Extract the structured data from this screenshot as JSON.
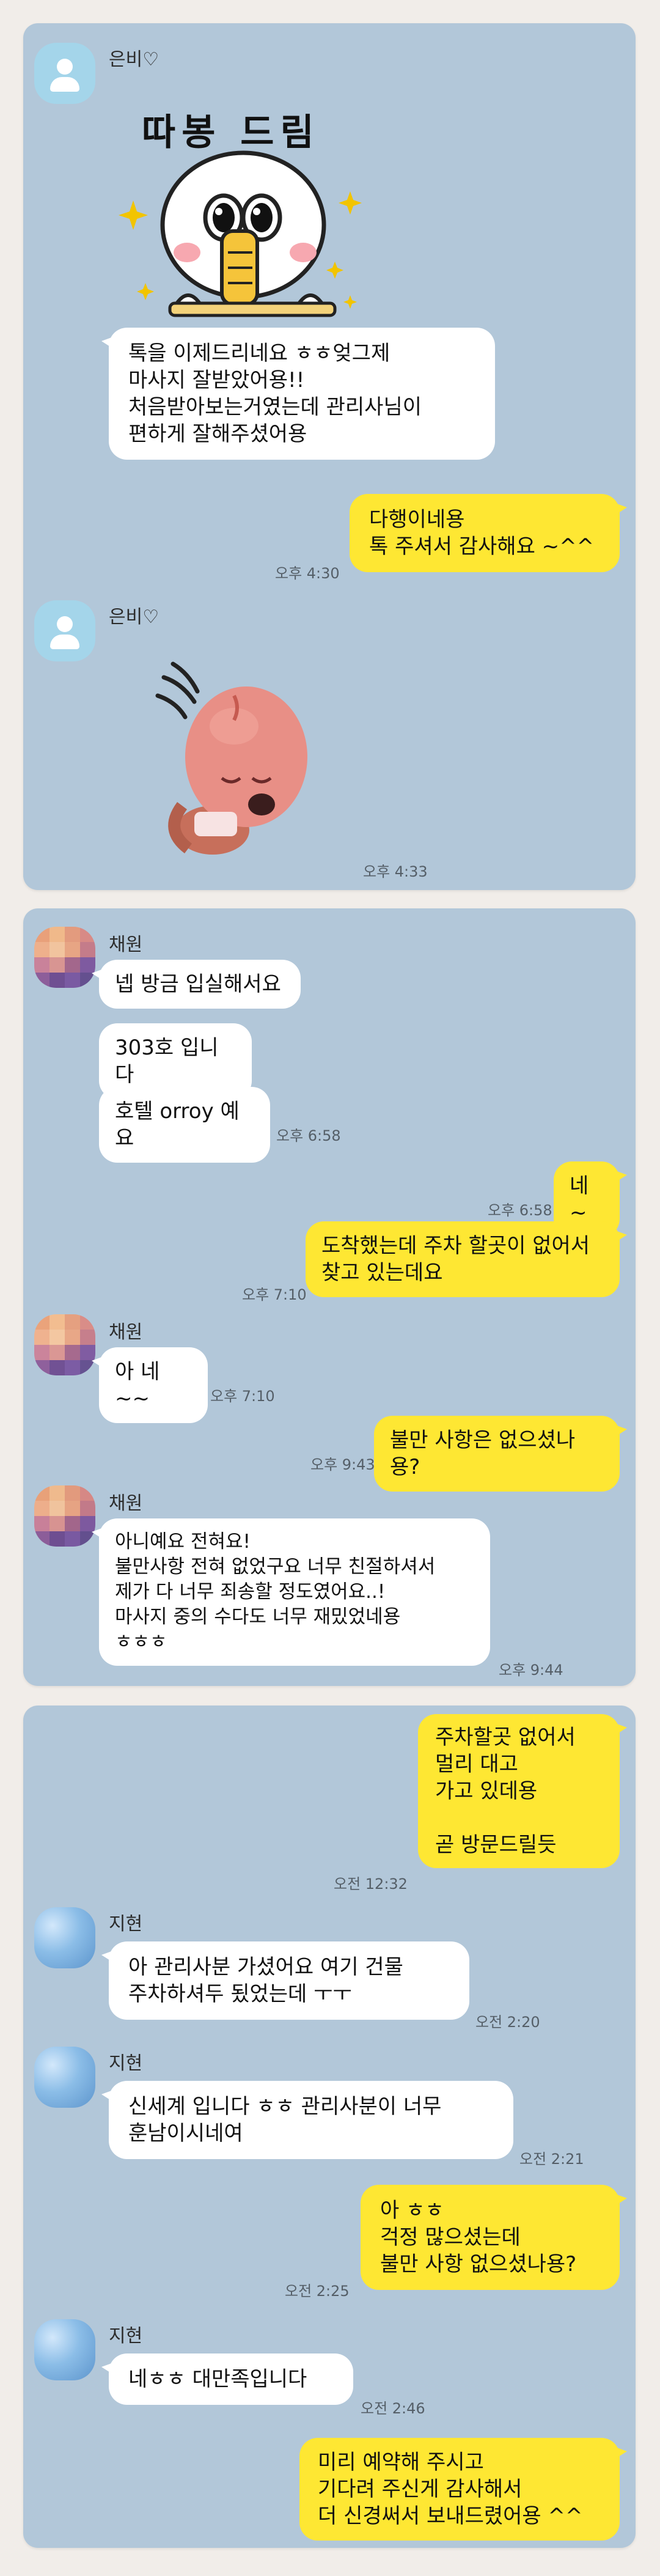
{
  "panel1": {
    "sender": "은비♡",
    "sticker1_caption": "따봉 드림",
    "msg1": "톡을 이제드리네요 ㅎㅎ엊그제\n마사지 잘받았어용!!\n처음받아보는거였는데 관리사님이\n편하게 잘해주셨어용",
    "reply": "다행이네용\n톡 주셔서 감사해요 ~^^",
    "reply_time": "오후 4:30",
    "sender2": "은비♡",
    "sticker2_time": "오후 4:33"
  },
  "panel2": {
    "sender": "채원",
    "msgs": [
      "넵 방금 입실해서요",
      "303호 입니다",
      "호텔 orroy 예요"
    ],
    "msgs_time": "오후 6:58",
    "out1": "네 ~",
    "out1_time": "오후 6:58",
    "out2": "도착했는데  주차 할곳이 없어서\n찾고 있는데요",
    "out2_time": "오후 7:10",
    "sender2": "채원",
    "in2": "아 네~~",
    "in2_time": "오후 7:10",
    "out3": "불만 사항은 없으셨나용?",
    "out3_time": "오후 9:43",
    "sender3": "채원",
    "in3": "아니예요 전혀요!\n불만사항 전혀 없었구요 너무 친절하셔서\n제가 다 너무 죄송할 정도였어요..!\n마사지 중의 수다도 너무 재밌었네용\nㅎㅎㅎ",
    "in3_time": "오후 9:44"
  },
  "panel3": {
    "out1": "주차할곳 없어서\n멀리 대고\n가고 있데용\n\n곧 방문드릴듯",
    "out1_time": "오전 12:32",
    "sender": "지현",
    "in1": "아 관리사분 가셨어요 여기 건물\n주차하셔두 됬었는데 ㅜㅜ",
    "in1_time": "오전 2:20",
    "sender2": "지현",
    "in2": "신세계 입니다 ㅎㅎ 관리사분이 너무\n훈남이시네여",
    "in2_time": "오전 2:21",
    "out2": "아 ㅎㅎ\n걱정 많으셨는데\n불만 사항 없으셨나용?",
    "out2_time": "오전 2:25",
    "sender3": "지현",
    "in3": "네ㅎㅎ 대만족입니다",
    "in3_time": "오전 2:46",
    "out3": "미리 예약해 주시고\n기다려 주신게 감사해서\n더 신경써서 보내드렸어용 ^^"
  },
  "colors": {
    "chat_bg": "#b2c7d9",
    "bubble_out": "#fee733",
    "bubble_in": "#ffffff",
    "page_bg": "#f1ede9"
  }
}
